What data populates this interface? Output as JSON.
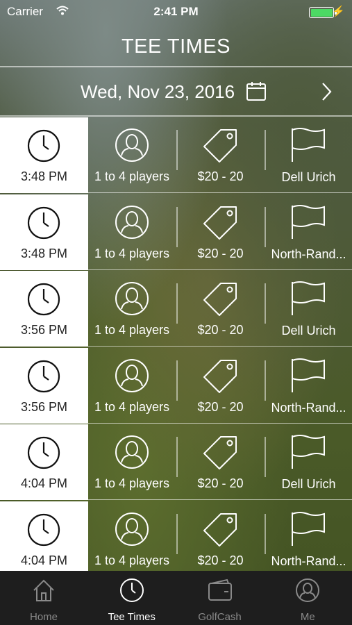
{
  "status_bar": {
    "carrier": "Carrier",
    "time": "2:41 PM",
    "battery_color": "#4cd964"
  },
  "header": {
    "title": "TEE TIMES"
  },
  "date_nav": {
    "date": "Wed, Nov 23, 2016",
    "calendar_icon": "calendar-icon",
    "next_icon": "chevron-right-icon"
  },
  "tee_times": [
    {
      "time": "3:48 PM",
      "players": "1 to 4 players",
      "price": "$20 - 20",
      "course": "Dell Urich"
    },
    {
      "time": "3:48 PM",
      "players": "1 to 4 players",
      "price": "$20 - 20",
      "course": "North-Rand..."
    },
    {
      "time": "3:56 PM",
      "players": "1 to 4 players",
      "price": "$20 - 20",
      "course": "Dell Urich"
    },
    {
      "time": "3:56 PM",
      "players": "1 to 4 players",
      "price": "$20 - 20",
      "course": "North-Rand..."
    },
    {
      "time": "4:04 PM",
      "players": "1 to 4 players",
      "price": "$20 - 20",
      "course": "Dell Urich"
    },
    {
      "time": "4:04 PM",
      "players": "1 to 4 players",
      "price": "$20 - 20",
      "course": "North-Rand..."
    }
  ],
  "tab_bar": {
    "tabs": [
      {
        "label": "Home",
        "icon": "home-icon"
      },
      {
        "label": "Tee Times",
        "icon": "clock-icon"
      },
      {
        "label": "GolfCash",
        "icon": "wallet-icon"
      },
      {
        "label": "Me",
        "icon": "user-icon"
      }
    ],
    "active": "Tee Times"
  }
}
